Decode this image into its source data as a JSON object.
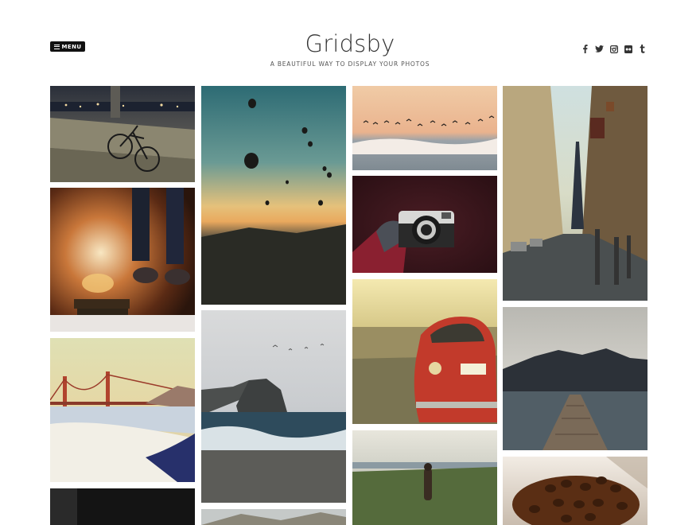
{
  "header": {
    "menu_label": "MENU",
    "site_title": "Gridsby",
    "tagline": "A BEAUTIFUL WAY TO DISPLAY YOUR PHOTOS"
  },
  "social": [
    "facebook-icon",
    "twitter-icon",
    "instagram-icon",
    "flickr-icon",
    "tumblr-icon"
  ],
  "photos": [
    {
      "name": "bicycle-bridge-photo"
    },
    {
      "name": "hot-air-balloons-photo"
    },
    {
      "name": "birds-sunset-photo"
    },
    {
      "name": "paris-street-photo"
    },
    {
      "name": "jumping-feet-photo"
    },
    {
      "name": "camera-in-hand-photo"
    },
    {
      "name": "golden-gate-bridge-photo"
    },
    {
      "name": "rocky-coast-photo"
    },
    {
      "name": "red-beetle-car-photo"
    },
    {
      "name": "lake-dock-photo"
    },
    {
      "name": "dark-photo"
    },
    {
      "name": "field-person-photo"
    },
    {
      "name": "coffee-beans-photo"
    }
  ]
}
